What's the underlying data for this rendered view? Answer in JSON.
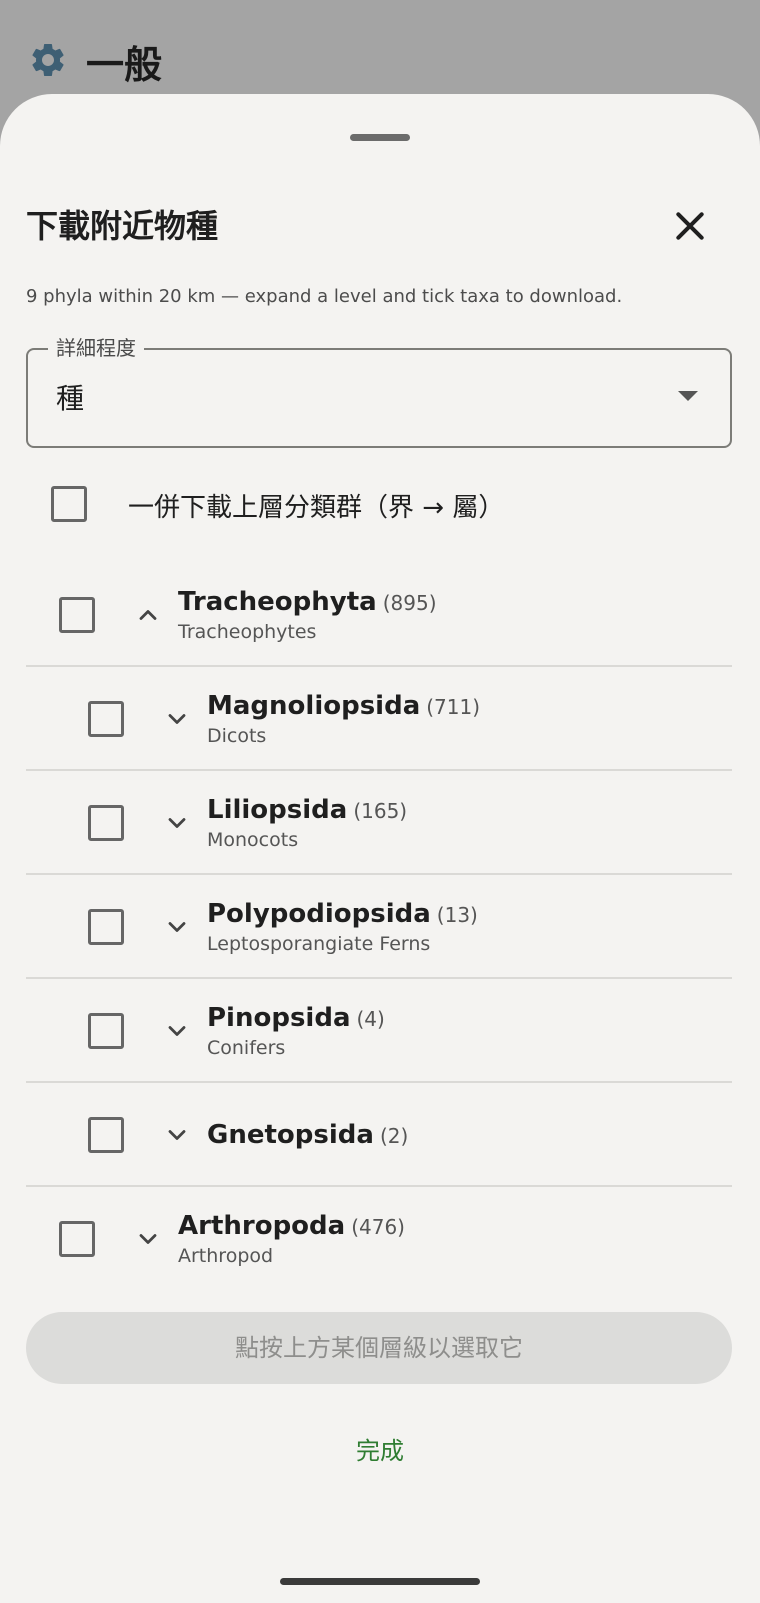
{
  "background": {
    "title": "一般",
    "icon": "gear-icon"
  },
  "sheet": {
    "title": "下載附近物種",
    "close_icon": "close-icon",
    "subtitle": "9 phyla within 20 km — expand a level and tick taxa to download.",
    "detail_level": {
      "label": "詳細程度",
      "value": "種"
    },
    "include_ancestors_label": "一併下載上層分類群（界 → 屬）",
    "taxa": [
      {
        "scientific": "Tracheophyta",
        "count": "(895)",
        "common": "Tracheophytes",
        "level": 0,
        "expanded": true,
        "checked": false
      },
      {
        "scientific": "Magnoliopsida",
        "count": "(711)",
        "common": "Dicots",
        "level": 1,
        "expanded": false,
        "checked": false
      },
      {
        "scientific": "Liliopsida",
        "count": "(165)",
        "common": "Monocots",
        "level": 1,
        "expanded": false,
        "checked": false
      },
      {
        "scientific": "Polypodiopsida",
        "count": "(13)",
        "common": "Leptosporangiate Ferns",
        "level": 1,
        "expanded": false,
        "checked": false
      },
      {
        "scientific": "Pinopsida",
        "count": "(4)",
        "common": "Conifers",
        "level": 1,
        "expanded": false,
        "checked": false
      },
      {
        "scientific": "Gnetopsida",
        "count": "(2)",
        "common": "",
        "level": 1,
        "expanded": false,
        "checked": false
      },
      {
        "scientific": "Arthropoda",
        "count": "(476)",
        "common": "Arthropod",
        "level": 0,
        "expanded": false,
        "checked": false
      }
    ],
    "select_hint_button": "點按上方某個層級以選取它",
    "done_button": "完成"
  },
  "colors": {
    "accent_green": "#2f7d32",
    "sheet_bg": "#f4f3f1",
    "scrim": "#9a9a9a"
  }
}
